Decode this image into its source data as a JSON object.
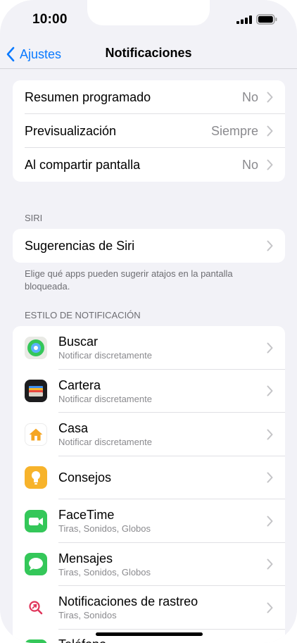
{
  "status_bar": {
    "time": "10:00"
  },
  "nav": {
    "back_label": "Ajustes",
    "title": "Notificaciones"
  },
  "general": [
    {
      "label": "Resumen programado",
      "value": "No"
    },
    {
      "label": "Previsualización",
      "value": "Siempre"
    },
    {
      "label": "Al compartir pantalla",
      "value": "No"
    }
  ],
  "siri": {
    "header": "SIRI",
    "item_label": "Sugerencias de Siri",
    "footnote": "Elige qué apps pueden sugerir atajos en la pantalla bloqueada."
  },
  "style": {
    "header": "ESTILO DE NOTIFICACIÓN",
    "apps": [
      {
        "name": "Buscar",
        "subtitle": "Notificar discretamente",
        "icon": "find-my-icon"
      },
      {
        "name": "Cartera",
        "subtitle": "Notificar discretamente",
        "icon": "wallet-icon"
      },
      {
        "name": "Casa",
        "subtitle": "Notificar discretamente",
        "icon": "home-icon"
      },
      {
        "name": "Consejos",
        "subtitle": "",
        "icon": "tips-icon"
      },
      {
        "name": "FaceTime",
        "subtitle": "Tiras, Sonidos, Globos",
        "icon": "facetime-icon"
      },
      {
        "name": "Mensajes",
        "subtitle": "Tiras, Sonidos, Globos",
        "icon": "messages-icon"
      },
      {
        "name": "Notificaciones de rastreo",
        "subtitle": "Tiras, Sonidos",
        "icon": "tracking-icon"
      },
      {
        "name": "Teléfono",
        "subtitle": "",
        "icon": "phone-icon"
      }
    ]
  },
  "colors": {
    "accent": "#0a7aff",
    "background": "#f2f2f7",
    "secondary_text": "#8a8a8e"
  }
}
